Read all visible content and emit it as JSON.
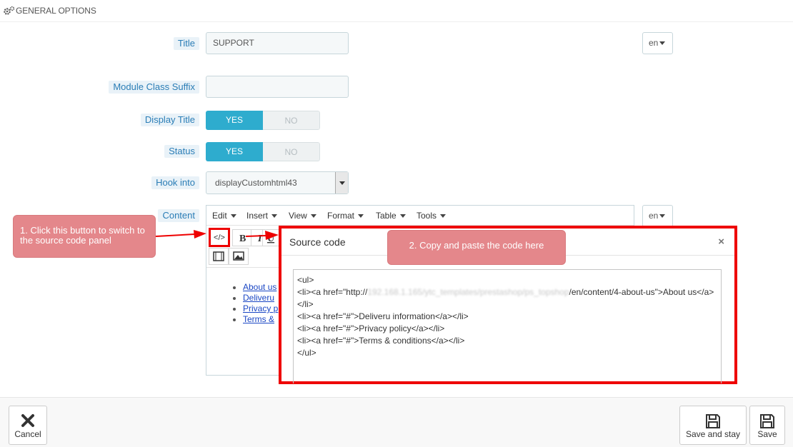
{
  "header": {
    "title": "GENERAL OPTIONS",
    "icon": "gears-icon"
  },
  "form": {
    "title": {
      "label": "Title",
      "value": "SUPPORT",
      "lang": "en"
    },
    "class_suffix": {
      "label": "Module Class Suffix",
      "value": ""
    },
    "display_title": {
      "label": "Display Title",
      "yes": "YES",
      "no": "NO",
      "state": "YES"
    },
    "status": {
      "label": "Status",
      "yes": "YES",
      "no": "NO",
      "state": "YES"
    },
    "hook": {
      "label": "Hook into",
      "value": "displayCustomhtml43"
    },
    "content": {
      "label": "Content",
      "lang": "en"
    }
  },
  "editor": {
    "menus": [
      "Edit",
      "Insert",
      "View",
      "Format",
      "Table",
      "Tools"
    ],
    "preview_links": [
      "About us",
      "Deliveru",
      "Privacy p",
      "Terms &"
    ]
  },
  "annotations": {
    "step1": "1. Click this button to switch to the source code panel",
    "step2": "2. Copy and paste the code here"
  },
  "source_modal": {
    "title": "Source code",
    "close": "×",
    "code_lines": {
      "l1": "<ul>",
      "l2a": "<li><a href=\"http://",
      "l2blur": "192.168.1.165/ytc_templates/prestashop/ps_topshop",
      "l2b": "/en/content/4-about-us\">About us</a></li>",
      "l3": "<li><a href=\"#\">Deliveru information</a></li>",
      "l4": "<li><a href=\"#\">Privacy policy</a></li>",
      "l5": "<li><a href=\"#\">Terms & conditions</a></li>",
      "l6": "</ul>"
    }
  },
  "footer": {
    "cancel": "Cancel",
    "save_stay": "Save and stay",
    "save": "Save"
  },
  "colors": {
    "accent": "#2eacce",
    "annotation": "#e4878b",
    "highlight": "#ee0000",
    "label_text": "#2a7db6"
  }
}
